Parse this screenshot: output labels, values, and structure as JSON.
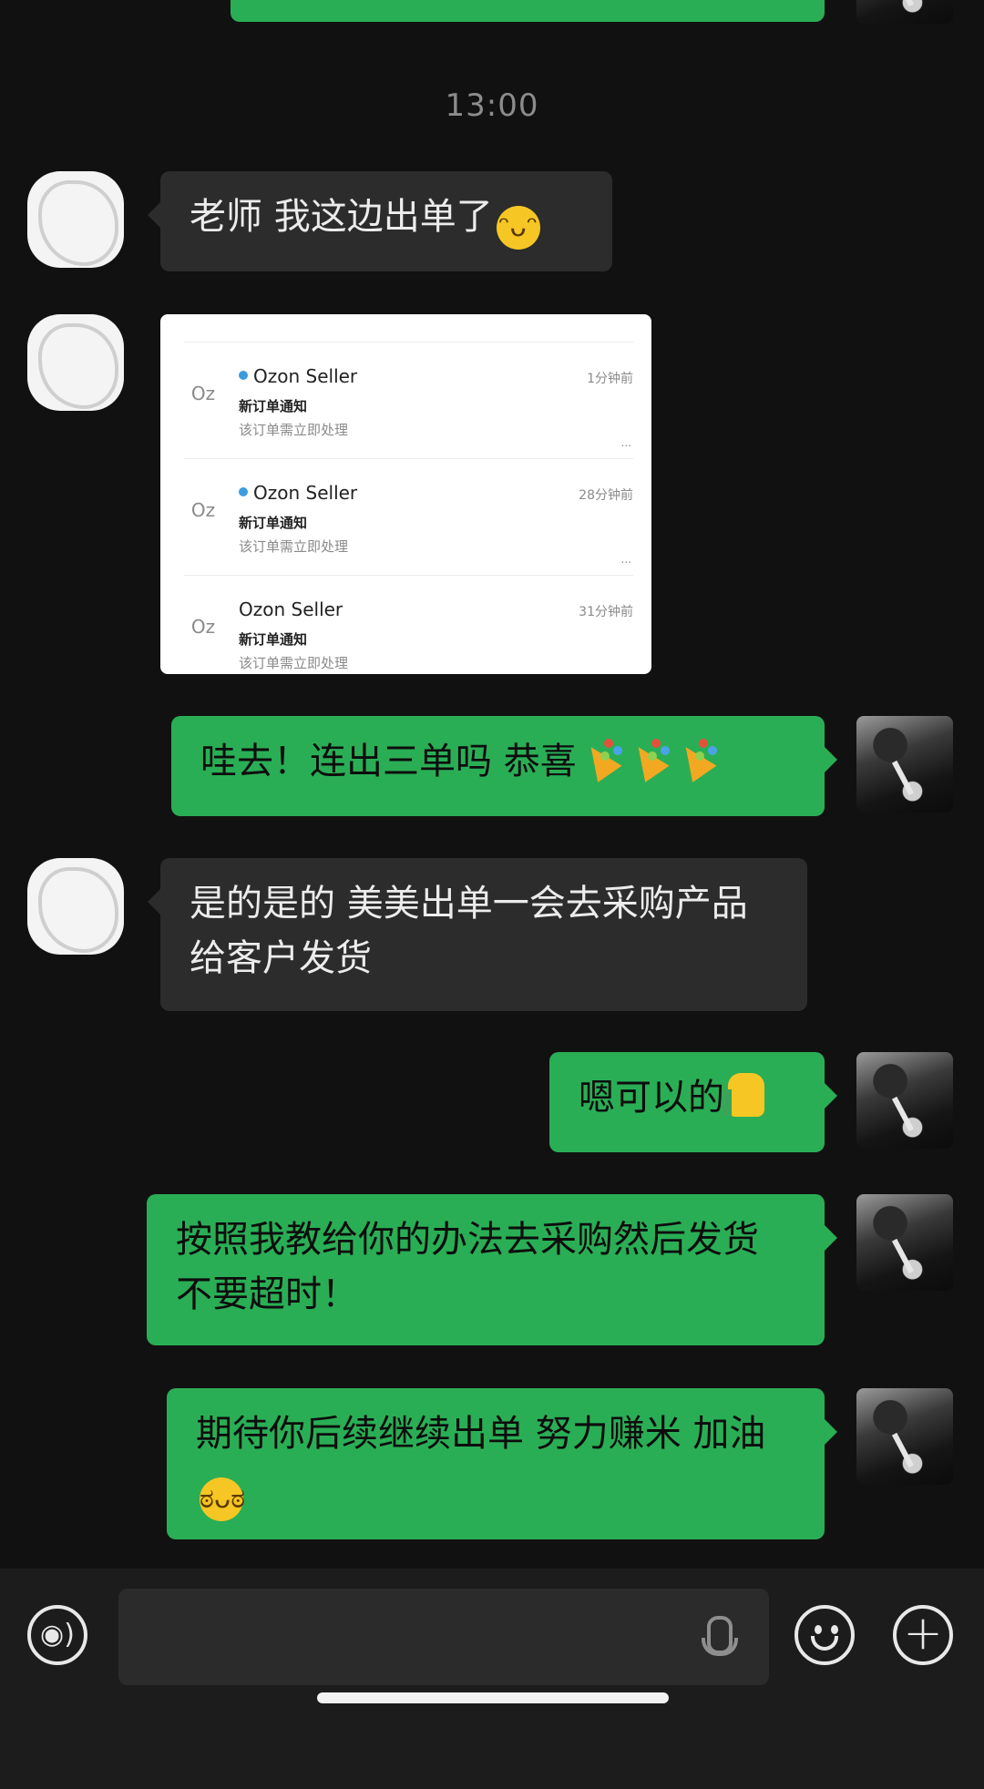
{
  "timestamp": "13:00",
  "messages": {
    "m1": {
      "text": "老师 我这边出单了",
      "emoji": "grinning-face-emoji"
    },
    "m3": {
      "text": "哇去！连出三单吗 恭喜",
      "emoji": "party-popper-emoji"
    },
    "m4": {
      "text": "是的是的 美美出单一会去采购产品给客户发货"
    },
    "m5": {
      "text": "嗯可以的",
      "emoji": "thumbs-up-emoji"
    },
    "m6": {
      "text": "按照我教给你的办法去采购然后发货 不要超时！"
    },
    "m7": {
      "text": "期待你后续继续出单 努力赚米 加油",
      "emoji": "determined-face-emoji"
    }
  },
  "notification_card": {
    "items": [
      {
        "icon": "Oz",
        "sender": "Ozon Seller",
        "unread": true,
        "title": "新订单通知",
        "body": "该订单需立即处理",
        "time": "1分钟前",
        "more": "..."
      },
      {
        "icon": "Oz",
        "sender": "Ozon Seller",
        "unread": true,
        "title": "新订单通知",
        "body": "该订单需立即处理",
        "time": "28分钟前",
        "more": "..."
      },
      {
        "icon": "Oz",
        "sender": "Ozon Seller",
        "unread": false,
        "title": "新订单通知",
        "body": "该订单需立即处理",
        "time": "31分钟前",
        "more": ""
      }
    ]
  },
  "input_bar": {
    "voice_icon": "voice-mode-icon",
    "mic_icon": "microphone-icon",
    "emoji_icon": "emoji-icon",
    "plus_icon": "plus-icon"
  },
  "colors": {
    "background": "#111111",
    "incoming_bubble": "#2c2c2c",
    "outgoing_bubble": "#2aae55",
    "input_bar": "#1c1c1c"
  }
}
